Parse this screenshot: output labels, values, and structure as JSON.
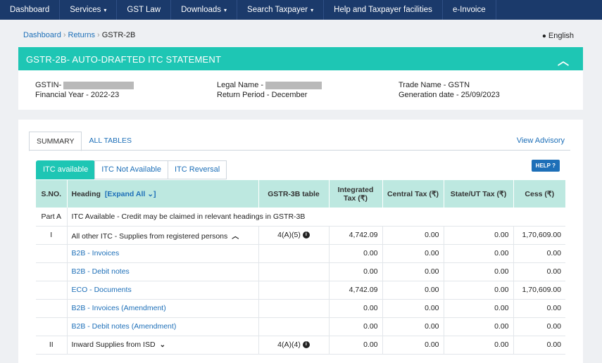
{
  "nav": {
    "items": [
      {
        "label": "Dashboard",
        "caret": ""
      },
      {
        "label": "Services",
        "caret": "▾"
      },
      {
        "label": "GST Law",
        "caret": ""
      },
      {
        "label": "Downloads",
        "caret": "▾"
      },
      {
        "label": "Search Taxpayer",
        "caret": "▾"
      },
      {
        "label": "Help and Taxpayer facilities",
        "caret": ""
      },
      {
        "label": "e-Invoice",
        "caret": ""
      }
    ]
  },
  "breadcrumb": {
    "dashboard": "Dashboard",
    "returns": "Returns",
    "current": "GSTR-2B"
  },
  "language": "English",
  "banner": {
    "title": "GSTR-2B- AUTO-DRAFTED ITC STATEMENT"
  },
  "info": {
    "gstin_label": "GSTIN-",
    "fy": "Financial Year - 2022-23",
    "legal_label": "Legal Name -",
    "period": "Return Period - December",
    "trade": "Trade Name - GSTN",
    "gen_date": "Generation date - 25/09/2023"
  },
  "tabs": {
    "summary": "SUMMARY",
    "all_tables": "ALL TABLES",
    "advisory": "View Advisory"
  },
  "subtabs": {
    "available": "ITC available",
    "not_available": "ITC Not Available",
    "reversal": "ITC Reversal"
  },
  "help_label": "HELP",
  "table": {
    "headers": {
      "sno": "S.NO.",
      "heading": "Heading",
      "expand": "[Expand All",
      "gstr3b": "GSTR-3B table",
      "igst": "Integrated Tax (₹)",
      "cgst": "Central Tax (₹)",
      "sgst": "State/UT Tax (₹)",
      "cess": "Cess (₹)"
    },
    "part_a": {
      "sno": "Part A",
      "text": "ITC Available - Credit may be claimed in relevant headings in GSTR-3B"
    },
    "rows": [
      {
        "sno": "I",
        "heading": "All other ITC - Supplies from registered persons",
        "table": "4(A)(5)",
        "igst": "4,742.09",
        "cgst": "0.00",
        "sgst": "0.00",
        "cess": "1,70,609.00"
      },
      {
        "sno": "",
        "heading": "B2B - Invoices",
        "table": "",
        "igst": "0.00",
        "cgst": "0.00",
        "sgst": "0.00",
        "cess": "0.00"
      },
      {
        "sno": "",
        "heading": "B2B - Debit notes",
        "table": "",
        "igst": "0.00",
        "cgst": "0.00",
        "sgst": "0.00",
        "cess": "0.00"
      },
      {
        "sno": "",
        "heading": "ECO - Documents",
        "table": "",
        "igst": "4,742.09",
        "cgst": "0.00",
        "sgst": "0.00",
        "cess": "1,70,609.00"
      },
      {
        "sno": "",
        "heading": "B2B - Invoices (Amendment)",
        "table": "",
        "igst": "0.00",
        "cgst": "0.00",
        "sgst": "0.00",
        "cess": "0.00"
      },
      {
        "sno": "",
        "heading": "B2B - Debit notes (Amendment)",
        "table": "",
        "igst": "0.00",
        "cgst": "0.00",
        "sgst": "0.00",
        "cess": "0.00"
      },
      {
        "sno": "II",
        "heading": "Inward Supplies from ISD",
        "table": "4(A)(4)",
        "igst": "0.00",
        "cgst": "0.00",
        "sgst": "0.00",
        "cess": "0.00"
      }
    ]
  },
  "colors": {
    "nav": "#1b3a6b",
    "accent": "#1ec6b4",
    "link": "#1d6fb8",
    "header_bg": "#bde8e0"
  }
}
